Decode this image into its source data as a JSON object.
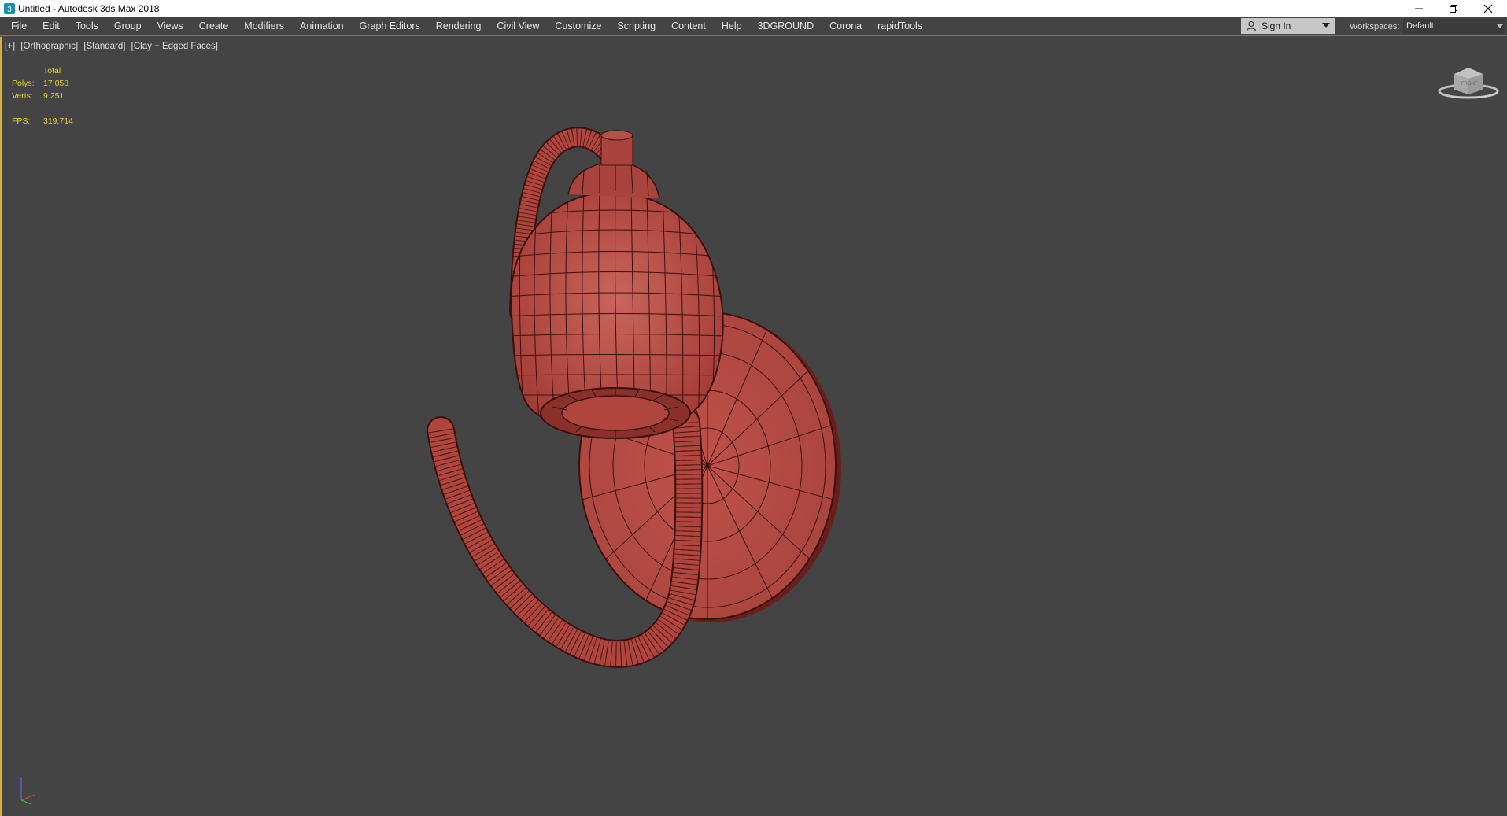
{
  "window": {
    "title": "Untitled - Autodesk 3ds Max 2018",
    "app_icon": "3ds-max-icon",
    "controls": [
      "minimize-icon",
      "restore-icon",
      "close-icon"
    ]
  },
  "menubar": {
    "items": [
      "File",
      "Edit",
      "Tools",
      "Group",
      "Views",
      "Create",
      "Modifiers",
      "Animation",
      "Graph Editors",
      "Rendering",
      "Civil View",
      "Customize",
      "Scripting",
      "Content",
      "Help",
      "3DGROUND",
      "Corona",
      "rapidTools"
    ],
    "sign_in": "Sign In",
    "workspaces_label": "Workspaces:",
    "workspace_value": "Default"
  },
  "viewport": {
    "labels": [
      "[+]",
      "[Orthographic]",
      "[Standard]",
      "[Clay + Edged Faces]"
    ],
    "stats": {
      "header": "Total",
      "polys_label": "Polys:",
      "polys_value": "17 058",
      "verts_label": "Verts:",
      "verts_value": "9 251",
      "fps_label": "FPS:",
      "fps_value": "319,714"
    },
    "viewcube_label": "FRONT",
    "colors": {
      "background": "#444444",
      "model": "#b5473f",
      "stats_text": "#e6d23a",
      "active_border": "#d4b04a"
    }
  }
}
